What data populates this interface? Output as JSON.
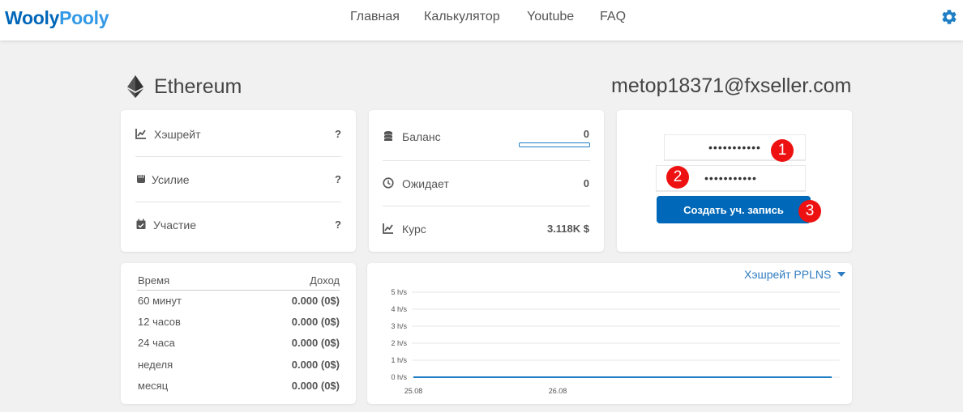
{
  "header": {
    "logo_part1": "Wooly",
    "logo_part2": "Pooly",
    "nav": [
      "Главная",
      "Калькулятор",
      "Youtube",
      "FAQ"
    ],
    "settings_icon": "gear-icon"
  },
  "coin": {
    "icon": "ethereum-icon",
    "title": "Ethereum"
  },
  "account": {
    "email": "metop18371@fxseller.com"
  },
  "stats_card": {
    "rows": [
      {
        "icon": "chart-icon",
        "label": "Хэшрейт",
        "value": "?"
      },
      {
        "icon": "fist-icon",
        "label": "Усилие",
        "value": "?"
      },
      {
        "icon": "calendar-check-icon",
        "label": "Участие",
        "value": "?"
      }
    ]
  },
  "balance_card": {
    "rows": [
      {
        "icon": "coins-icon",
        "label": "Баланс",
        "value": "0",
        "progress": 0
      },
      {
        "icon": "clock-icon",
        "label": "Ожидает",
        "value": "0"
      },
      {
        "icon": "chart-icon",
        "label": "Курс",
        "value": "3.118K $"
      }
    ]
  },
  "register_card": {
    "password1": "•••••••••••",
    "password2": "•••••••••••",
    "button_label": "Создать уч. запись",
    "badges": [
      "1",
      "2",
      "3"
    ],
    "badge_color": "#e11111"
  },
  "income_table": {
    "headers": [
      "Время",
      "Доход"
    ],
    "rows": [
      {
        "period": "60 минут",
        "value": "0.000 (0$)"
      },
      {
        "period": "12 часов",
        "value": "0.000 (0$)"
      },
      {
        "period": "24 часа",
        "value": "0.000 (0$)"
      },
      {
        "period": "неделя",
        "value": "0.000 (0$)"
      },
      {
        "period": "месяц",
        "value": "0.000 (0$)"
      }
    ]
  },
  "hashrate_chart": {
    "selector_label": "Хэшрейт PPLNS",
    "dropdown_icon": "caret-down-icon"
  },
  "chart_data": {
    "type": "line",
    "title": "",
    "xlabel": "",
    "ylabel": "",
    "y_ticks": [
      "5 h/s",
      "4 h/s",
      "3 h/s",
      "2 h/s",
      "1 h/s",
      "0 h/s"
    ],
    "ylim": [
      0,
      5
    ],
    "x_ticks": [
      "25.08",
      "26.08"
    ],
    "series": [
      {
        "values": [
          0,
          0
        ]
      }
    ],
    "grid": true,
    "line_color": "#1f7ec4"
  },
  "colors": {
    "brand_primary": "#0066b8",
    "brand_secondary": "#3399e6",
    "accent_link": "#2f7cc0"
  }
}
